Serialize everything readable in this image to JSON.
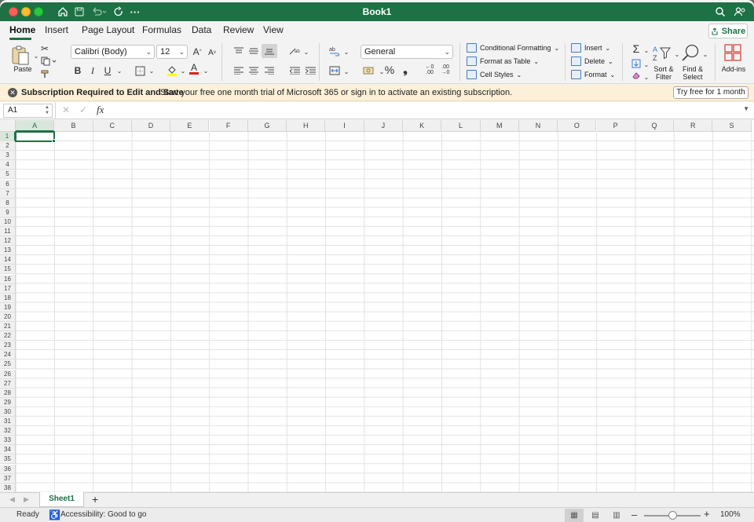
{
  "app": {
    "title": "Book1",
    "accent": "#1e7145"
  },
  "tabs": [
    "Home",
    "Insert",
    "Page Layout",
    "Formulas",
    "Data",
    "Review",
    "View"
  ],
  "active_tab": "Home",
  "share_label": "Share",
  "ribbon": {
    "paste_label": "Paste",
    "font_name": "Calibri (Body)",
    "font_size": "12",
    "number_format": "General",
    "conditional_formatting": "Conditional Formatting",
    "format_as_table": "Format as Table",
    "cell_styles": "Cell Styles",
    "insert": "Insert",
    "delete": "Delete",
    "format": "Format",
    "sort_filter": "Sort &\nFilter",
    "find_select": "Find &\nSelect",
    "addins": "Add-ins"
  },
  "banner": {
    "title": "Subscription Required to Edit and Save",
    "message": "Start your free one month trial of Microsoft 365 or sign in to activate an existing subscription.",
    "button": "Try free for 1 month"
  },
  "formula_bar": {
    "name_box": "A1",
    "fx": "fx",
    "value": ""
  },
  "grid": {
    "columns": [
      "A",
      "B",
      "C",
      "D",
      "E",
      "F",
      "G",
      "H",
      "I",
      "J",
      "K",
      "L",
      "M",
      "N",
      "O",
      "P",
      "Q",
      "R",
      "S"
    ],
    "rows": [
      "1",
      "2",
      "3",
      "4",
      "5",
      "6",
      "7",
      "8",
      "9",
      "10",
      "11",
      "12",
      "13",
      "14",
      "15",
      "16",
      "17",
      "18",
      "19",
      "20",
      "21",
      "22",
      "23",
      "24",
      "25",
      "26",
      "27",
      "28",
      "29",
      "30",
      "31",
      "32",
      "33",
      "34",
      "35",
      "36",
      "37",
      "38"
    ],
    "selected": "A1"
  },
  "sheets": [
    "Sheet1"
  ],
  "active_sheet": "Sheet1",
  "status": {
    "ready": "Ready",
    "accessibility": "Accessibility: Good to go",
    "zoom": "100%",
    "zoom_value": 100
  }
}
